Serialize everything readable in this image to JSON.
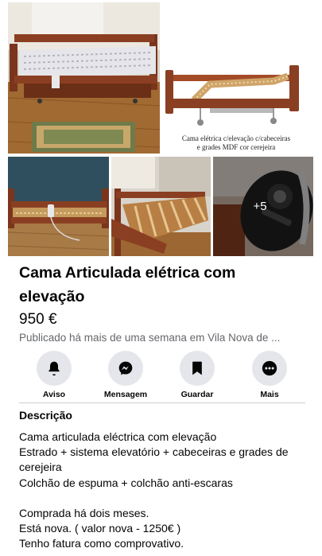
{
  "gallery": {
    "caption_line1": "Cama elétrica c/elevação c/cabeceiras",
    "caption_line2": "e grades MDF cor cerejeira",
    "more_count": "+5"
  },
  "listing": {
    "title": "Cama Articulada elétrica com elevação",
    "price": "950 €",
    "meta": "Publicado há mais de uma semana em Vila Nova de ..."
  },
  "actions": [
    {
      "label": "Aviso",
      "icon": "bell-icon"
    },
    {
      "label": "Mensagem",
      "icon": "messenger-icon"
    },
    {
      "label": "Guardar",
      "icon": "bookmark-icon"
    },
    {
      "label": "Mais",
      "icon": "more-icon"
    }
  ],
  "description": {
    "heading": "Descrição",
    "lines": [
      "Cama articulada eléctrica com elevação",
      "Estrado + sistema elevatório + cabeceiras e grades de cerejeira",
      "Colchão de espuma + colchão anti-escaras",
      "",
      "Comprada há dois meses.",
      "Está nova. ( valor nova - 1250€ )",
      "Tenho fatura como comprovativo."
    ]
  },
  "colors": {
    "wood": "#8b3f22",
    "icon_circle_bg": "#e4e6eb",
    "meta_text": "#65676b"
  }
}
